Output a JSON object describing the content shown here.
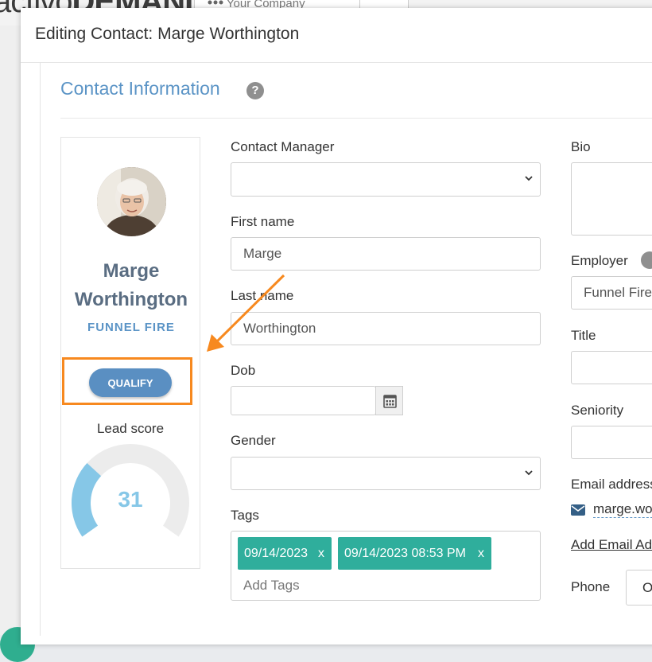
{
  "background": {
    "logo_light": "activo",
    "logo_bold": "DEMAND",
    "company_switcher": "Your Company"
  },
  "modal": {
    "title": "Editing Contact: Marge Worthington"
  },
  "section": {
    "title": "Contact Information",
    "help": "?"
  },
  "profile": {
    "first_name": "Marge",
    "last_name": "Worthington",
    "company": "FUNNEL FIRE",
    "qualify_label": "QUALIFY",
    "lead_score_label": "Lead score",
    "lead_score": 31,
    "lead_score_max": 100
  },
  "form": {
    "contact_manager": {
      "label": "Contact Manager",
      "value": ""
    },
    "first_name": {
      "label": "First name",
      "value": "Marge"
    },
    "last_name": {
      "label": "Last name",
      "value": "Worthington"
    },
    "dob": {
      "label": "Dob",
      "value": ""
    },
    "gender": {
      "label": "Gender",
      "value": ""
    },
    "tags": {
      "label": "Tags",
      "items": [
        {
          "text": "09/14/2023",
          "remove": "x"
        },
        {
          "text": "09/14/2023 08:53 PM",
          "remove": "x"
        }
      ],
      "placeholder": "Add Tags"
    }
  },
  "right": {
    "bio": {
      "label": "Bio"
    },
    "employer": {
      "label": "Employer",
      "value": "Funnel Fire"
    },
    "title": {
      "label": "Title"
    },
    "seniority": {
      "label": "Seniority"
    },
    "email": {
      "label": "Email address",
      "value": "marge.wo"
    },
    "add_email": "Add Email Ad",
    "phone": {
      "label": "Phone",
      "value": "O"
    }
  },
  "colors": {
    "accent_blue": "#5b94c6",
    "highlight_orange": "#f7891f",
    "tag_teal": "#2fae9c",
    "gauge_fill": "#86c7e7",
    "gauge_track": "#ececec"
  }
}
